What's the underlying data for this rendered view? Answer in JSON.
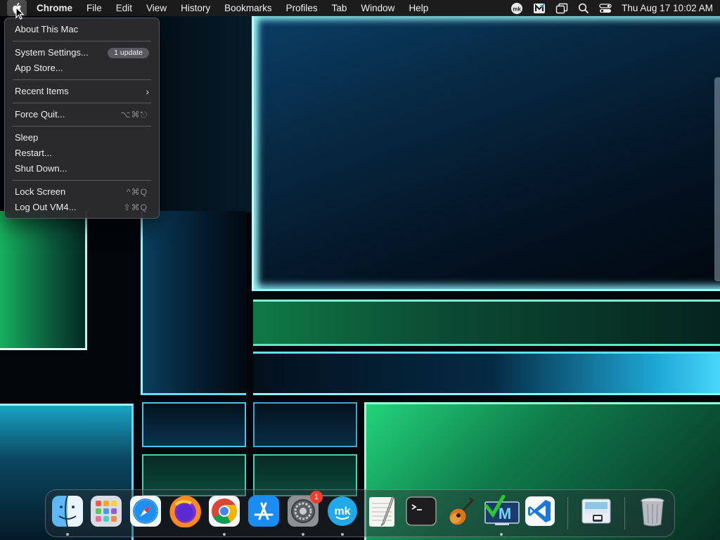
{
  "menubar": {
    "app_name": "Chrome",
    "menus": [
      "File",
      "Edit",
      "View",
      "History",
      "Bookmarks",
      "Profiles",
      "Tab",
      "Window",
      "Help"
    ],
    "status_icons": [
      "mk-icon",
      "malwarebytes-icon",
      "screen-mirroring-icon",
      "spotlight-search-icon",
      "control-center-icon"
    ],
    "clock": "Thu Aug 17  10:02 AM"
  },
  "apple_menu": {
    "about": "About This Mac",
    "system_settings": "System Settings...",
    "system_settings_badge": "1 update",
    "app_store": "App Store...",
    "recent_items": "Recent Items",
    "recent_items_chevron": "›",
    "force_quit": "Force Quit...",
    "force_quit_shortcut": "⌥⌘⎋",
    "sleep": "Sleep",
    "restart": "Restart...",
    "shut_down": "Shut Down...",
    "lock_screen": "Lock Screen",
    "lock_screen_shortcut": "^⌘Q",
    "log_out": "Log Out VM4...",
    "log_out_shortcut": "⇧⌘Q"
  },
  "dock": {
    "apps": [
      {
        "name": "Finder",
        "running": true
      },
      {
        "name": "Launchpad",
        "running": false
      },
      {
        "name": "Safari",
        "running": false
      },
      {
        "name": "Firefox",
        "running": false
      },
      {
        "name": "Google Chrome",
        "running": true
      },
      {
        "name": "App Store",
        "running": false
      },
      {
        "name": "System Settings",
        "running": true,
        "badge": "1"
      },
      {
        "name": "MK",
        "running": true
      },
      {
        "name": "TextEdit",
        "running": false
      },
      {
        "name": "Terminal",
        "running": false
      },
      {
        "name": "GarageBand",
        "running": false
      },
      {
        "name": "Malwarebytes Check",
        "running": true
      },
      {
        "name": "Visual Studio Code",
        "running": false
      }
    ],
    "other": [
      {
        "name": "Preview Document"
      },
      {
        "name": "Trash"
      }
    ]
  },
  "colors": {
    "menubar_bg": "#1e1e20",
    "menu_bg": "#2c2c2e",
    "badge_red": "#ff3b30"
  }
}
